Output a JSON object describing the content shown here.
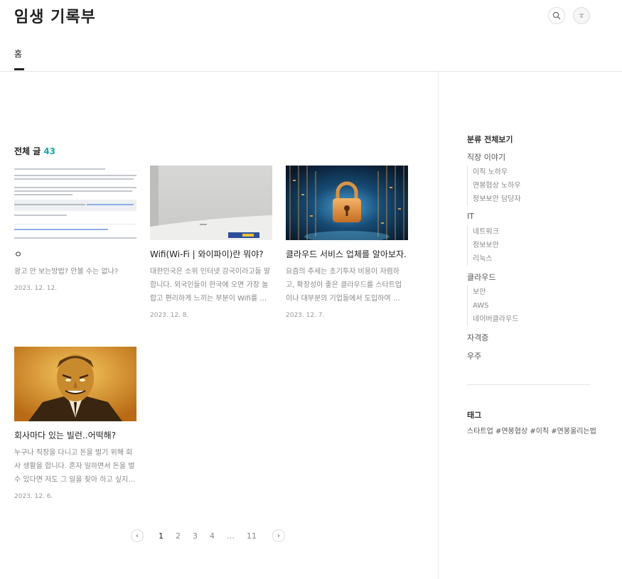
{
  "site": {
    "title": "임생 기록부"
  },
  "nav": {
    "home": "홈"
  },
  "icons": {
    "search": "search-icon",
    "profile": "profile-icon"
  },
  "section": {
    "label": "전체 글",
    "count": "43"
  },
  "posts": [
    {
      "title": "ㅇ",
      "excerpt": "광고 안 보는방법? 안볼 수는 없나?",
      "date": "2023. 12. 12."
    },
    {
      "title": "Wifi(Wi-Fi | 와이파이)란 뭐야?",
      "excerpt": "대한민국은 소위 인터넷 강국이라고들 말합니다. 외국인들이 한국에 오면 가장 놀랍고 편리하게 느끼는 부분이 Wifi를 …",
      "date": "2023. 12. 8."
    },
    {
      "title": "클라우드 서비스 업체를 알아보자.",
      "excerpt": "요즘의 추세는 초기투자 비용이 저렴하고, 확장성이 좋은 클라우드를 스타트업이나 대부분의 기업들에서 도입하여 …",
      "date": "2023. 12. 7."
    },
    {
      "title": "회사마다 있는 빌런..어떡해?",
      "excerpt": "누구나 직장을 다니고 돈을 벌기 위해 회사 생활을 합니다. 혼자 일하면서 돈을 벌수 있다면 저도 그 일을 찾아 하고 싶지…",
      "date": "2023. 12. 6."
    }
  ],
  "pagination": {
    "prev": "‹",
    "pages": [
      "1",
      "2",
      "3",
      "4",
      "…",
      "11"
    ],
    "next": "›",
    "current": "1"
  },
  "sidebar": {
    "categories_title": "분류 전체보기",
    "categories": [
      {
        "name": "직장 이야기",
        "children": [
          "이직 노하우",
          "연봉협상 노하우",
          "정보보안 담당자"
        ]
      },
      {
        "name": "IT",
        "children": [
          "네트워크",
          "정보보안",
          "리눅스"
        ]
      },
      {
        "name": "클라우드",
        "children": [
          "보안",
          "AWS",
          "네이버클라우드"
        ]
      },
      {
        "name": "자격증",
        "children": []
      },
      {
        "name": "우주",
        "children": []
      }
    ],
    "tags_title": "태그",
    "tags": "스타트업 #연봉협상 #이직 #연봉올리는법"
  }
}
